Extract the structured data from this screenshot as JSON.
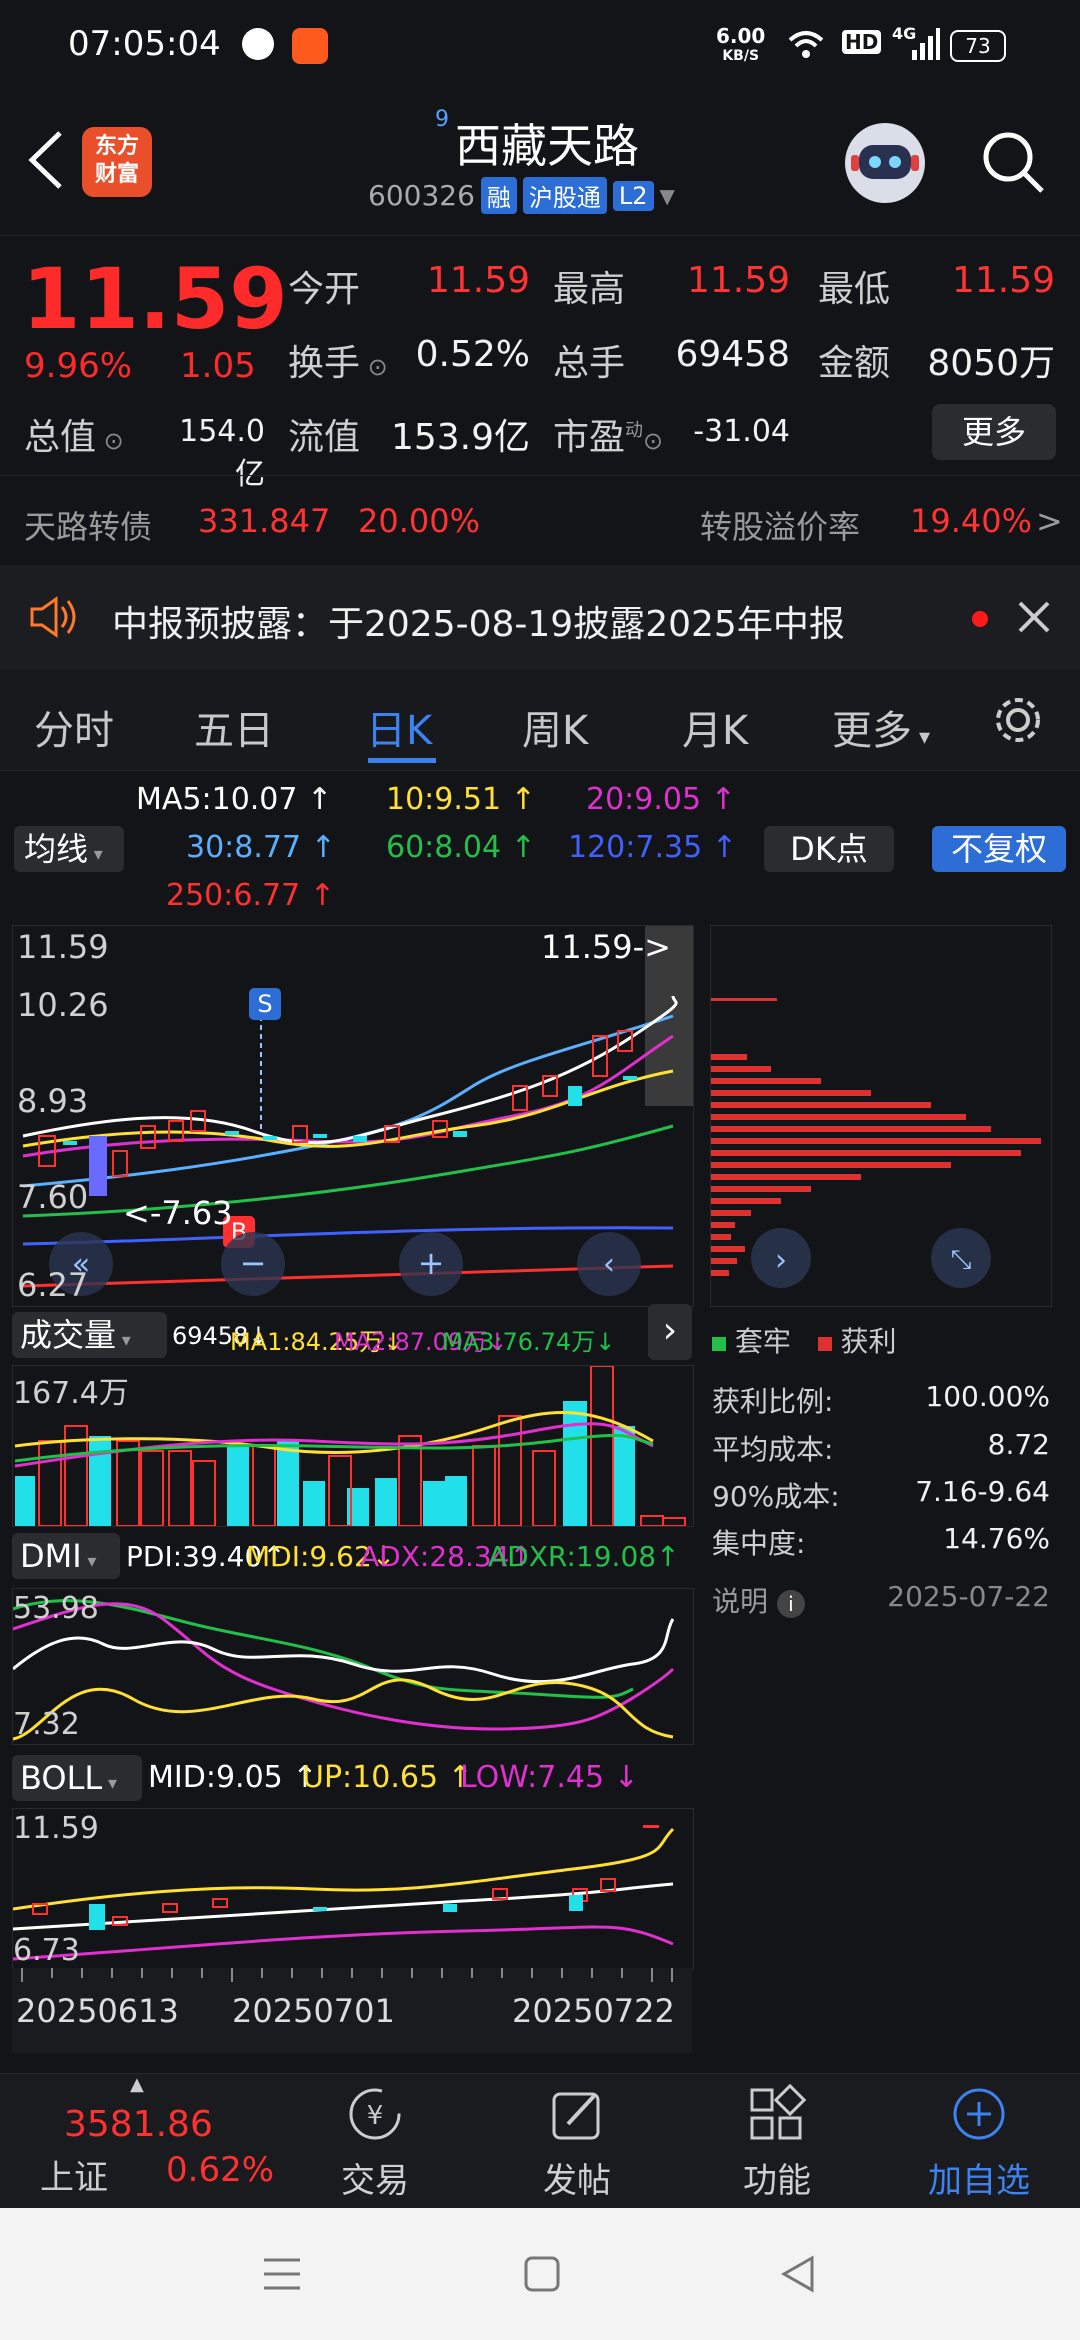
{
  "status": {
    "time": "07:05:04",
    "net_speed": "6.00",
    "net_unit": "KB/S",
    "battery": "73",
    "hd": "HD",
    "net_gen": "4G"
  },
  "header": {
    "logo_line1": "东方",
    "logo_line2": "财富",
    "sup": "9",
    "name": "西藏天路",
    "code": "600326",
    "tags": [
      "融",
      "沪股通",
      "L2"
    ]
  },
  "quote": {
    "price": "11.59",
    "pct": "9.96%",
    "chg": "1.05",
    "open_label": "今开",
    "open": "11.59",
    "high_label": "最高",
    "high": "11.59",
    "low_label": "最低",
    "low": "11.59",
    "turnover_label": "换手",
    "turnover": "0.52%",
    "vol_label": "总手",
    "vol": "69458",
    "amt_label": "金额",
    "amt": "8050万",
    "mcap_label": "总值",
    "mcap": "154.0亿",
    "float_label": "流值",
    "float": "153.9亿",
    "pe_label": "市盈",
    "pe_sup": "动",
    "pe": "-31.04",
    "more": "更多"
  },
  "bond": {
    "name": "天路转债",
    "price": "331.847",
    "pct": "20.00%",
    "premium_label": "转股溢价率",
    "premium": "19.40%",
    "arrow": ">"
  },
  "notice": {
    "text": "中报预披露：于2025-08-19披露2025年中报"
  },
  "tabs": [
    "分时",
    "五日",
    "日K",
    "周K",
    "月K",
    "更多"
  ],
  "ma": {
    "label": "均线",
    "ma5": "MA5:10.07",
    "ma10": "10:9.51",
    "ma20": "20:9.05",
    "ma30": "30:8.77",
    "ma60": "60:8.04",
    "ma120": "120:7.35",
    "ma250": "250:6.77",
    "dk": "DK点",
    "fq": "不复权"
  },
  "kline": {
    "y_top": "11.59",
    "y_1": "10.26",
    "y_2": "8.93",
    "y_3": "7.60",
    "y_bottom": "6.27",
    "marker_current": "11.59->",
    "marker_low": "<-7.63",
    "s_mark": "S",
    "b_mark": "B"
  },
  "volume": {
    "label": "成交量",
    "v": "69458",
    "ma1": "MA1:84.25万",
    "ma2": "MA2:87.09万",
    "ma3": "MA3:76.74万",
    "y_top": "167.4万"
  },
  "dmi": {
    "label": "DMI",
    "pdi": "PDI:39.40",
    "mdi": "MDI:9.62",
    "adx": "ADX:28.34",
    "adxr": "ADXR:19.08",
    "y_top": "53.98",
    "y_bottom": "7.32"
  },
  "boll": {
    "label": "BOLL",
    "mid": "MID:9.05",
    "up": "UP:10.65",
    "low": "LOW:7.45",
    "y_top": "11.59",
    "y_bottom": "6.73"
  },
  "dates": [
    "20250613",
    "20250701",
    "20250722"
  ],
  "chips": {
    "legend_trapped": "套牢",
    "legend_profit": "获利",
    "rows": [
      {
        "label": "获利比例:",
        "value": "100.00%"
      },
      {
        "label": "平均成本:",
        "value": "8.72"
      },
      {
        "label": "90%成本:",
        "value": "7.16-9.64"
      },
      {
        "label": "集中度:",
        "value": "14.76%"
      }
    ],
    "note": "说明",
    "date": "2025-07-22"
  },
  "bottom": {
    "index_value": "3581.86",
    "index_name": "上证",
    "index_pct": "0.62%",
    "trade": "交易",
    "post": "发帖",
    "func": "功能",
    "add": "加自选"
  },
  "colors": {
    "up": "#ff2a2a",
    "down": "#22e0ea",
    "accent": "#3d82f0",
    "ma5": "#ffffff",
    "ma10": "#ffe033",
    "ma20": "#e030d0",
    "ma30": "#5ab0ff",
    "ma60": "#22c04a",
    "ma120": "#4060ff",
    "ma250": "#ff3030"
  }
}
